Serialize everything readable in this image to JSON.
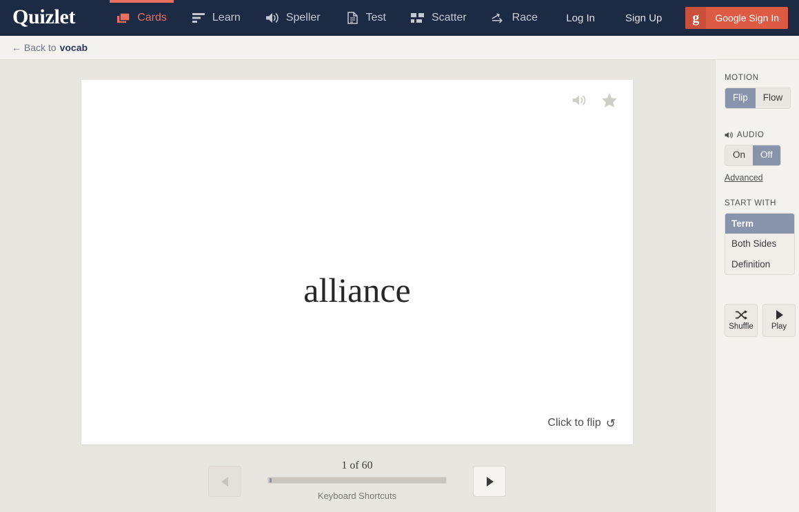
{
  "navbar": {
    "brand": "Quizlet",
    "items": [
      {
        "label": "Cards",
        "icon": "cards-icon",
        "active": true
      },
      {
        "label": "Learn",
        "icon": "learn-icon",
        "active": false
      },
      {
        "label": "Speller",
        "icon": "speaker-icon",
        "active": false
      },
      {
        "label": "Test",
        "icon": "document-icon",
        "active": false
      },
      {
        "label": "Scatter",
        "icon": "scatter-icon",
        "active": false
      },
      {
        "label": "Race",
        "icon": "race-icon",
        "active": false
      }
    ],
    "login_label": "Log In",
    "signup_label": "Sign Up",
    "google_label": "Google Sign In",
    "google_glyph": "g",
    "accent_color": "#e8705f",
    "background_color": "#1c2a44"
  },
  "breadcrumb": {
    "arrow": "←",
    "prefix": "Back to",
    "target": "vocab"
  },
  "card": {
    "term": "alliance",
    "flip_hint": "Click to flip",
    "flip_glyph": "↺",
    "audio_icon": "speaker-icon",
    "star_icon": "star-icon"
  },
  "controls": {
    "counter": "1 of 60",
    "current": 1,
    "total": 60,
    "progress_percent": 1.7,
    "prev_label": "◀",
    "next_label": "▶",
    "prev_disabled": true,
    "keyboard_shortcuts": "Keyboard Shortcuts"
  },
  "sidebar": {
    "motion": {
      "label": "MOTION",
      "options": [
        "Flip",
        "Flow"
      ],
      "selected": "Flip"
    },
    "audio": {
      "label": "AUDIO",
      "icon": "speaker-icon",
      "options": [
        "On",
        "Off"
      ],
      "selected": "Off",
      "advanced_label": "Advanced"
    },
    "start_with": {
      "label": "START WITH",
      "options": [
        "Term",
        "Both Sides",
        "Definition"
      ],
      "selected": "Term"
    },
    "actions": [
      {
        "label": "Shuffle",
        "icon": "shuffle-icon"
      },
      {
        "label": "Play",
        "icon": "play-icon"
      }
    ],
    "selected_color": "#8794ac"
  }
}
